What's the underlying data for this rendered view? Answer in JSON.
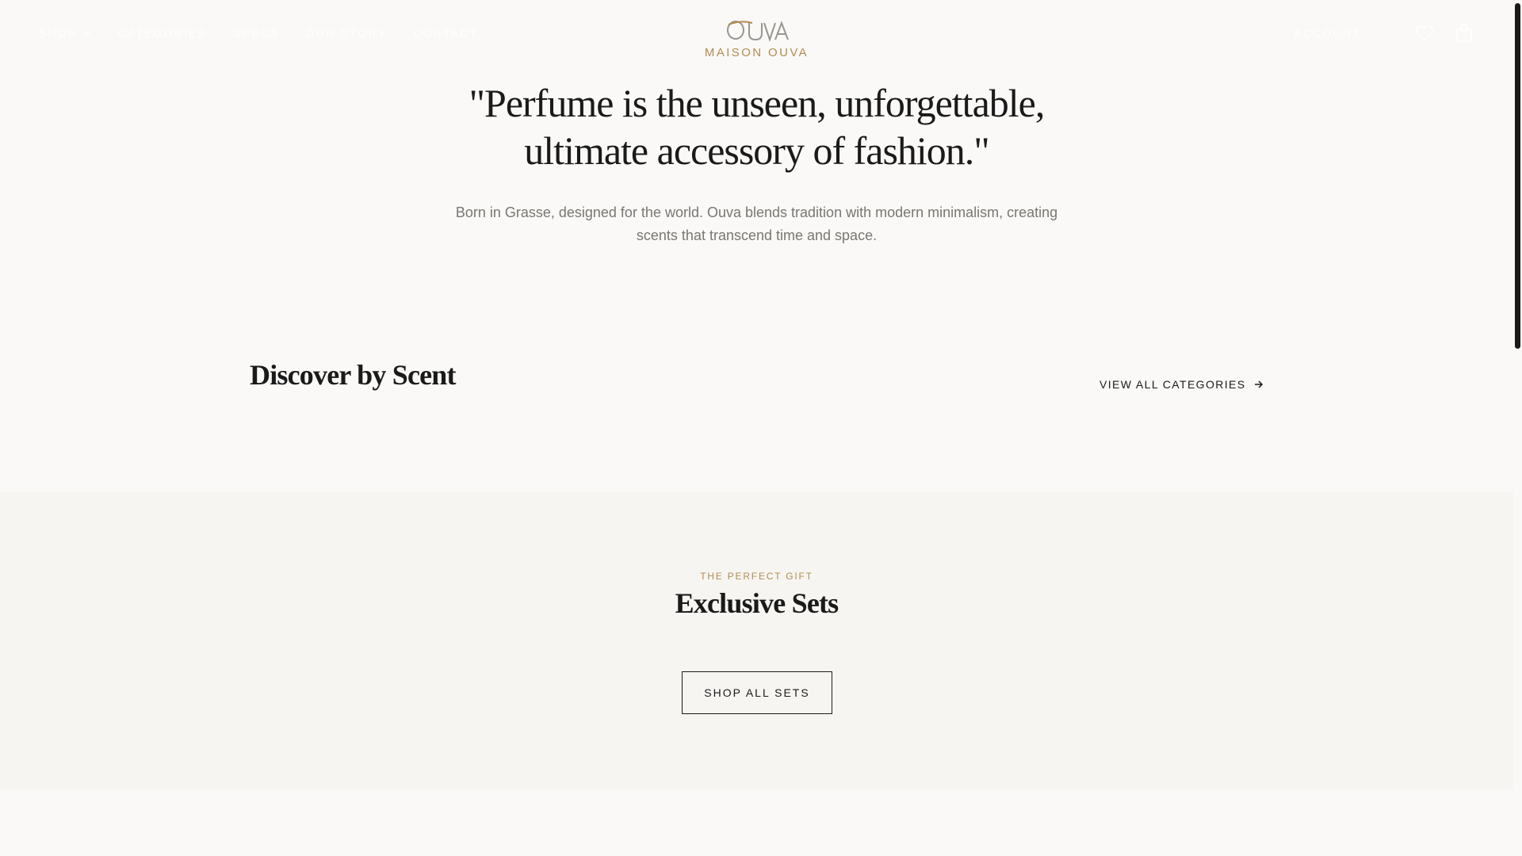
{
  "header": {
    "nav": [
      {
        "label": "SHOP",
        "has_dropdown": true
      },
      {
        "label": "CATEGORIES"
      },
      {
        "label": "SPECS"
      },
      {
        "label": "OUR STORY"
      },
      {
        "label": "CONTACT"
      }
    ],
    "brand_subtitle": "MAISON OUVA",
    "account_label": "ACCOUNT",
    "icons": {
      "wishlist": "heart-icon",
      "bag": "shopping-bag-icon",
      "dropdown": "chevron-down-icon"
    },
    "colors": {
      "gold": "#b38b52",
      "nav_text": "#ffffff"
    }
  },
  "hero": {
    "quote_line1": "\"Perfume is the unseen, unforgettable,",
    "quote_line2": "ultimate accessory of fashion.\"",
    "intro_line1": "Born in Grasse, designed for the world. Ouva blends tradition with modern minimalism, creating",
    "intro_line2": "scents that transcend time and space."
  },
  "discover": {
    "title": "Discover by Scent",
    "view_all_label": "VIEW ALL CATEGORIES"
  },
  "sets": {
    "eyebrow": "THE PERFECT GIFT",
    "title": "Exclusive Sets",
    "button_label": "SHOP ALL SETS"
  }
}
